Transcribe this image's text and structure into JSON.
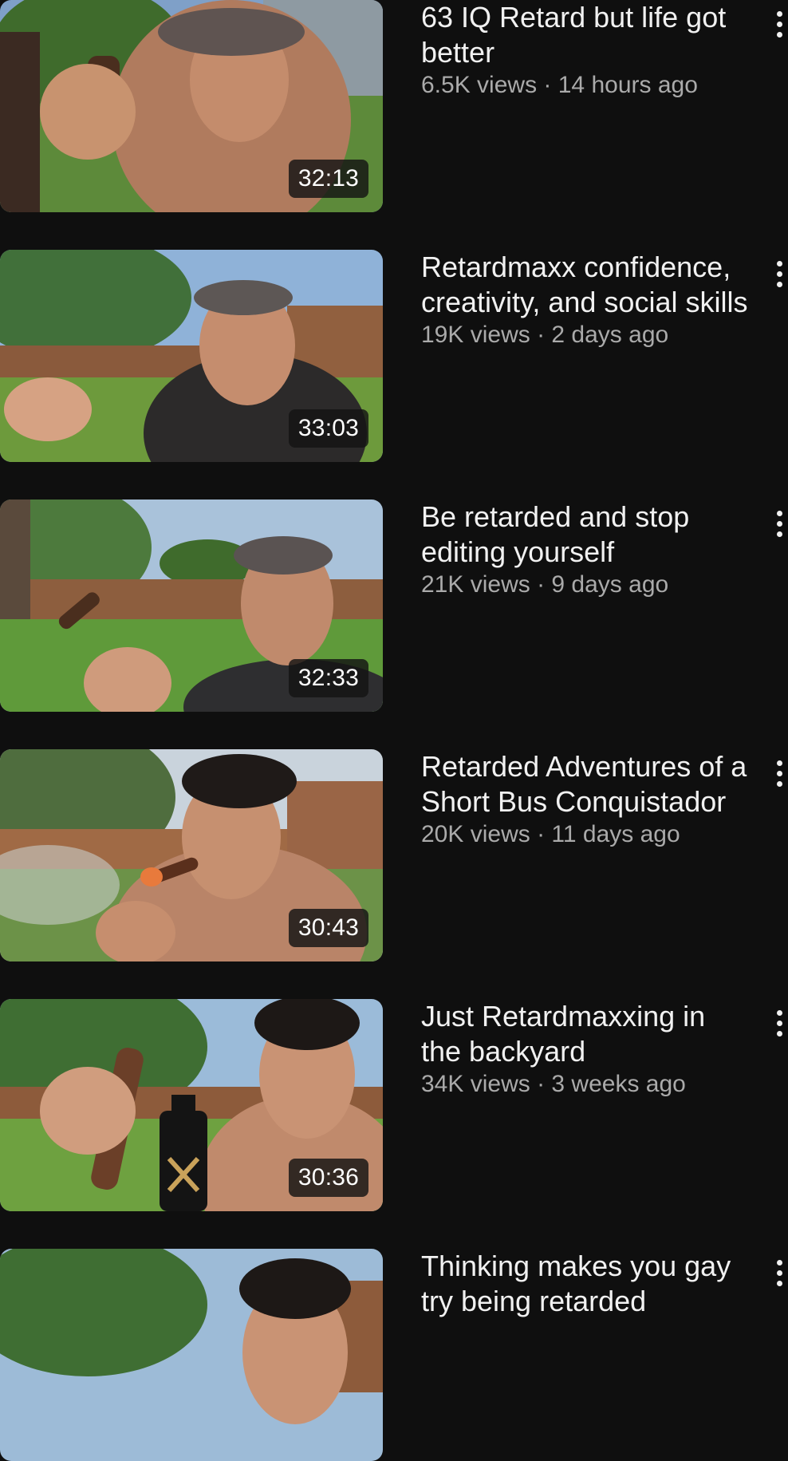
{
  "videos": [
    {
      "title": "63 IQ Retard but life got better",
      "views": "6.5K views",
      "age": "14 hours ago",
      "duration": "32:13"
    },
    {
      "title": "Retardmaxx confidence, creativity, and social skills",
      "views": "19K views",
      "age": "2 days ago",
      "duration": "33:03"
    },
    {
      "title": "Be retarded and stop editing yourself",
      "views": "21K views",
      "age": "9 days ago",
      "duration": "32:33"
    },
    {
      "title": "Retarded Adventures of a Short Bus Conquistador",
      "views": "20K views",
      "age": "11 days ago",
      "duration": "30:43"
    },
    {
      "title": "Just Retardmaxxing in the backyard",
      "views": "34K views",
      "age": "3 weeks ago",
      "duration": "30:36"
    },
    {
      "title": "Thinking makes you gay try being retarded",
      "views": "",
      "age": "",
      "duration": ""
    }
  ],
  "meta_separator": " · ",
  "icons": {
    "more": "more-vert-icon"
  },
  "colors": {
    "background": "#0f0f0f",
    "title": "#f1f1f1",
    "meta": "#aaaaaa",
    "duration_badge": "#141414"
  }
}
